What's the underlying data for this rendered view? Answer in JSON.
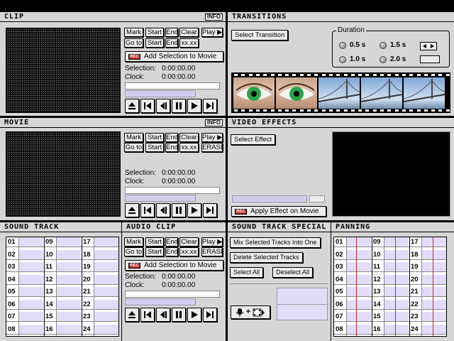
{
  "clip": {
    "title": "CLIP",
    "info": "INFO",
    "buttons": [
      "Mark",
      "Start",
      "End",
      "Clear",
      "Play ▶",
      "Go to",
      "Start",
      "End",
      "xx.xx"
    ],
    "add_selection": "Add Selection to Movie",
    "rec_badge": "REC",
    "selection_label": "Selection:",
    "selection_value": "0:00:00.00",
    "clock_label": "Clock:",
    "clock_value": "0:00:00.00",
    "slider_level": 0.82
  },
  "transitions": {
    "title": "TRANSITIONS",
    "select_button": "Select Transition",
    "duration_label": "Duration",
    "options": [
      "0.5 s",
      "1.5 s",
      "1.0 s",
      "2.0 s"
    ],
    "thumbnails": [
      "eye",
      "eye",
      "bridge",
      "bridge",
      "bridge"
    ]
  },
  "movie": {
    "title": "MOVIE",
    "info": "INFO",
    "buttons": [
      "Mark",
      "Start",
      "End",
      "Clear",
      "Play ▶",
      "Go to",
      "Start",
      "End",
      "xx.xx",
      "ERASE"
    ],
    "selection_label": "Selection:",
    "selection_value": "0:00:00.00",
    "clock_label": "Clock:",
    "clock_value": "0:00:00.00",
    "slider_level": 0.82
  },
  "video_effects": {
    "title": "VIDEO EFFECTS",
    "select_button": "Select Effect",
    "apply_button": "Apply Effect on Movie",
    "rec_badge": "REC"
  },
  "sound_track": {
    "title": "SOUND TRACK",
    "tracks": [
      "01",
      "02",
      "03",
      "04",
      "05",
      "06",
      "07",
      "08",
      "09",
      "10",
      "11",
      "12",
      "13",
      "14",
      "15",
      "16",
      "17",
      "18",
      "19",
      "20",
      "21",
      "22",
      "23",
      "24"
    ]
  },
  "audio_clip": {
    "title": "AUDIO CLIP",
    "buttons": [
      "Mark",
      "Start",
      "End",
      "Clear",
      "Play ▶",
      "Go to",
      "Start",
      "End",
      "xx.xx",
      "ERASE"
    ],
    "add_selection": "Add Selection to Movie",
    "rec_badge": "REC",
    "selection_label": "Selection:",
    "selection_value": "0:00:00.00",
    "clock_label": "Clock:",
    "clock_value": "0:00:00.00",
    "slider_level": 0.82
  },
  "sound_track_special": {
    "title": "SOUND TRACK SPECIAL",
    "mix_button": "Mix Selected Tracks Into One",
    "delete_button": "Delete Selected Tracks",
    "select_all": "Select All",
    "deselect_all": "Deselect All"
  },
  "panning": {
    "title": "PANNING",
    "tracks": [
      "01",
      "02",
      "03",
      "04",
      "05",
      "06",
      "07",
      "08",
      "09",
      "10",
      "11",
      "12",
      "13",
      "14",
      "15",
      "16",
      "17",
      "18",
      "19",
      "20",
      "21",
      "22",
      "23",
      "24"
    ]
  }
}
